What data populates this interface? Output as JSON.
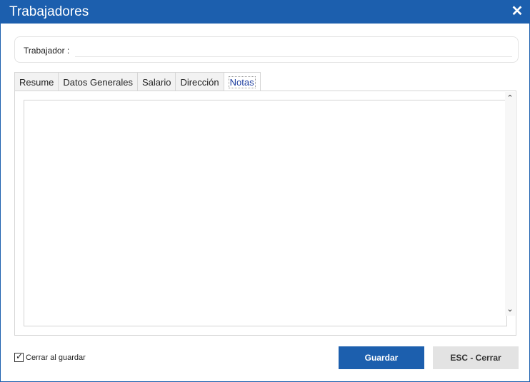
{
  "window": {
    "title": "Trabajadores"
  },
  "worker": {
    "label": "Trabajador :",
    "value": ""
  },
  "tabs": [
    {
      "label": "Resume",
      "active": false
    },
    {
      "label": "Datos Generales",
      "active": false
    },
    {
      "label": "Salario",
      "active": false
    },
    {
      "label": "Dirección",
      "active": false
    },
    {
      "label": "Notas",
      "active": true
    }
  ],
  "notes": {
    "value": ""
  },
  "footer": {
    "close_on_save_label": "Cerrar al guardar",
    "close_on_save_checked": true,
    "save_label": "Guardar",
    "close_label": "ESC - Cerrar"
  },
  "icons": {
    "close": "close-icon",
    "scroll_up": "chevron-up-icon",
    "scroll_down": "chevron-down-icon"
  },
  "colors": {
    "title_bar": "#1c5fae",
    "primary_button": "#1c5fae",
    "secondary_button": "#e3e3e3"
  }
}
